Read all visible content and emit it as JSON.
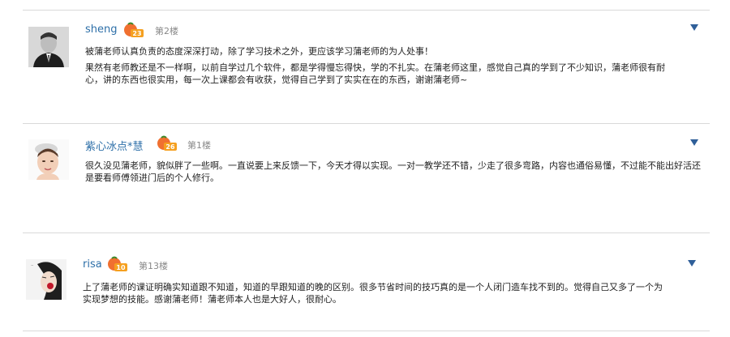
{
  "posts": [
    {
      "username": "sheng",
      "level": "23",
      "floor": "第2楼",
      "lines": [
        "被蒲老师认真负责的态度深深打动，除了学习技术之外，更应该学习蒲老师的为人处事！",
        "果然有老师教还是不一样啊，以前自学过几个软件，都是学得慢忘得快，学的不扎实。在蒲老师这里，感觉自己真的学到了不少知识，蒲老师很有耐心，讲的东西也很实用，每一次上课都会有收获，觉得自己学到了实实在在的东西，谢谢蒲老师~"
      ]
    },
    {
      "username": "紫心冰点*慧",
      "level": "26",
      "floor": "第1楼",
      "lines": [
        "很久没见蒲老师，貌似胖了一些啊。一直说要上来反馈一下，今天才得以实现。一对一教学还不错，少走了很多弯路，内容也通俗易懂，不过能不能出好活还是要看师傅领进门后的个人修行。"
      ]
    },
    {
      "username": "risa",
      "level": "10",
      "floor": "第13楼",
      "lines": [
        "上了蒲老师的课证明确实知道跟不知道，知道的早跟知道的晚的区别。很多节省时间的技巧真的是一个人闭门造车找不到的。觉得自己又多了一个为实现梦想的技能。感谢蒲老师！蒲老师本人也是大好人，很耐心。"
      ]
    }
  ],
  "icons": {
    "badge": "tomato-level-icon",
    "expand": "triangle-down-icon"
  },
  "colors": {
    "username": "#2d6fa8",
    "arrow": "#2f5f99",
    "badge": "#f07030",
    "divider": "#d9d9d9"
  }
}
